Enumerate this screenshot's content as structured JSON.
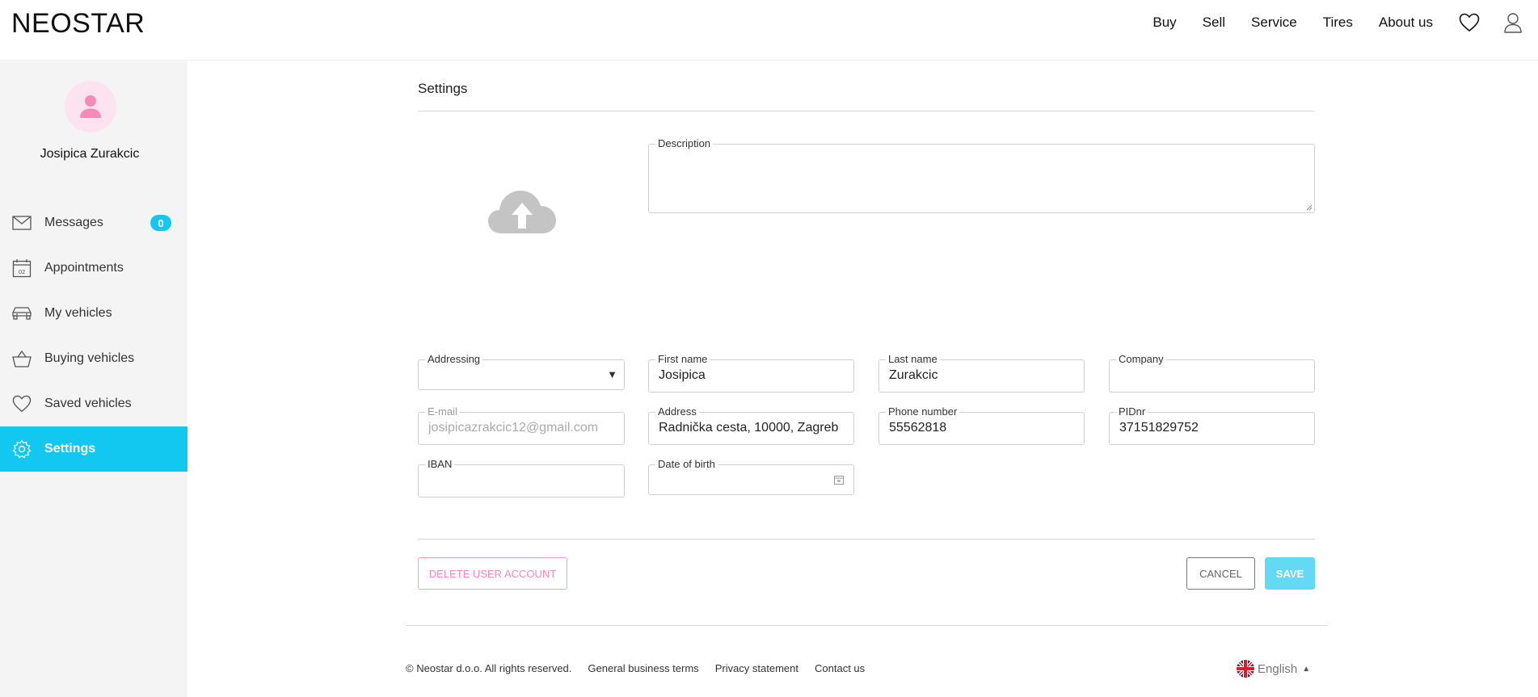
{
  "header": {
    "logo": "NEOSTAR",
    "nav": [
      "Buy",
      "Sell",
      "Service",
      "Tires",
      "About us"
    ],
    "icons": [
      "heart-icon",
      "user-icon"
    ]
  },
  "sidebar": {
    "user_name": "Josipica Zurakcic",
    "items": [
      {
        "label": "Messages",
        "icon": "envelope-icon",
        "badge": "0"
      },
      {
        "label": "Appointments",
        "icon": "calendar-icon",
        "calendar_day": "02"
      },
      {
        "label": "My vehicles",
        "icon": "car-icon"
      },
      {
        "label": "Buying vehicles",
        "icon": "basket-icon"
      },
      {
        "label": "Saved vehicles",
        "icon": "heart-icon"
      },
      {
        "label": "Settings",
        "icon": "gear-icon",
        "active": true
      }
    ]
  },
  "main": {
    "title": "Settings",
    "upload_icon": "cloud-upload-icon",
    "fields": {
      "description": {
        "label": "Description",
        "value": ""
      },
      "addressing": {
        "label": "Addressing",
        "value": ""
      },
      "first_name": {
        "label": "First name",
        "value": "Josipica"
      },
      "last_name": {
        "label": "Last name",
        "value": "Zurakcic"
      },
      "company": {
        "label": "Company",
        "value": ""
      },
      "email": {
        "label": "E-mail",
        "value": "josipicazrakcic12@gmail.com"
      },
      "address": {
        "label": "Address",
        "value": "Radnička cesta, 10000, Zagreb"
      },
      "phone": {
        "label": "Phone number",
        "value": "55562818"
      },
      "pidnr": {
        "label": "PIDnr",
        "value": "37151829752"
      },
      "iban": {
        "label": "IBAN",
        "value": ""
      },
      "dob": {
        "label": "Date of birth",
        "value": ""
      }
    },
    "buttons": {
      "delete": "DELETE USER ACCOUNT",
      "cancel": "CANCEL",
      "save": "SAVE"
    }
  },
  "footer": {
    "copyright": "© Neostar d.o.o. All rights reserved.",
    "links": [
      "General business terms",
      "Privacy statement",
      "Contact us"
    ],
    "language": "English"
  },
  "colors": {
    "accent": "#12c8f1",
    "save": "#63d9f6",
    "delete": "#f48ab6",
    "avatar_bg": "#fde3ef",
    "avatar_fg": "#f48ab6"
  }
}
